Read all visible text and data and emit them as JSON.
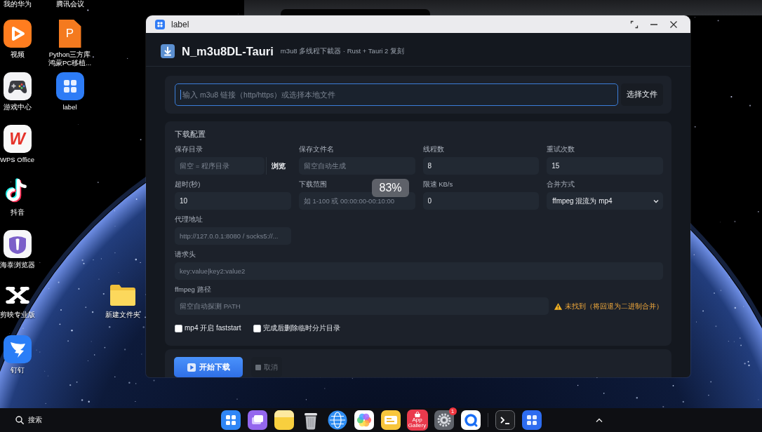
{
  "desktop": {
    "icons": [
      {
        "label": "我的华为",
        "kind": "offscreen"
      },
      {
        "label": "腾讯会议",
        "kind": "offscreen"
      },
      {
        "label": "视频",
        "kind": "video"
      },
      {
        "label": "Python三方库鸿蒙PC移植...",
        "kind": "document",
        "glyph": "P"
      },
      {
        "label": "游戏中心",
        "kind": "gamepad"
      },
      {
        "label": "label",
        "kind": "grid"
      },
      {
        "label": "WPS Office",
        "kind": "letter",
        "glyph": "W"
      },
      {
        "label": "抖音",
        "kind": "note"
      },
      {
        "label": "海泰浏览器",
        "kind": "browser"
      },
      {
        "label": "剪映专业版",
        "kind": "cut"
      },
      {
        "label": "新建文件夹",
        "kind": "folder"
      },
      {
        "label": "钉钉",
        "kind": "wing"
      }
    ]
  },
  "window": {
    "title": "label"
  },
  "app": {
    "title": "N_m3u8DL-Tauri",
    "subtitle": "m3u8 多线程下載器 · Rust + Tauri 2 复刻",
    "source": {
      "placeholder": "输入 m3u8 链接（http/https）或选择本地文件",
      "focused": true,
      "button": "选择文件"
    },
    "config": {
      "heading": "下载配置",
      "fields": [
        {
          "label": "保存目录",
          "kind": "text",
          "placeholder": "留空 = 程序目录",
          "button": "浏览"
        },
        {
          "label": "保存文件名",
          "kind": "text",
          "placeholder": "留空自动生成"
        },
        {
          "label": "线程数",
          "kind": "text",
          "value": "8"
        },
        {
          "label": "重试次数",
          "kind": "text",
          "value": "15"
        },
        {
          "label": "超时(秒)",
          "kind": "text",
          "value": "10"
        },
        {
          "label": "下载范围",
          "kind": "text",
          "placeholder": "如 1-100 或 00:00:00-00:10:00"
        },
        {
          "label": "限速 KB/s",
          "kind": "text",
          "value": "0"
        },
        {
          "label": "合并方式",
          "kind": "select",
          "value": "ffmpeg 混流为 mp4"
        },
        {
          "label": "代理地址",
          "kind": "text",
          "placeholder": "http://127.0.0.1:8080 / socks5://..."
        },
        {
          "label": "请求头",
          "kind": "wide",
          "placeholder": "key:value|key2:value2"
        },
        {
          "label": "ffmpeg 路径",
          "kind": "wide",
          "placeholder": "留空自动探测 PATH",
          "warning": "未找到（将回退为二进制合并）"
        }
      ],
      "options": [
        {
          "label": "mp4 开启 faststart",
          "checked": false
        },
        {
          "label": "完成后删除临时分片目录",
          "checked": false
        }
      ]
    },
    "actions": [
      {
        "label": "开始下载",
        "kind": "primary",
        "disabled": false
      },
      {
        "label": "取消",
        "kind": "secondary",
        "disabled": true
      }
    ]
  },
  "overlay": {
    "text": "83%"
  },
  "taskbar": {
    "search": "搜索",
    "dock": [
      {
        "kind": "launcher"
      },
      {
        "kind": "multitask"
      },
      {
        "kind": "notes"
      },
      {
        "kind": "trash"
      },
      {
        "kind": "globe"
      },
      {
        "kind": "gallery"
      },
      {
        "kind": "wallet"
      },
      {
        "kind": "appstore",
        "label": "App Gallery"
      },
      {
        "kind": "settings",
        "badge": "1"
      },
      {
        "kind": "chat"
      },
      {
        "kind": "separator"
      },
      {
        "kind": "terminal"
      },
      {
        "kind": "grid"
      }
    ]
  }
}
